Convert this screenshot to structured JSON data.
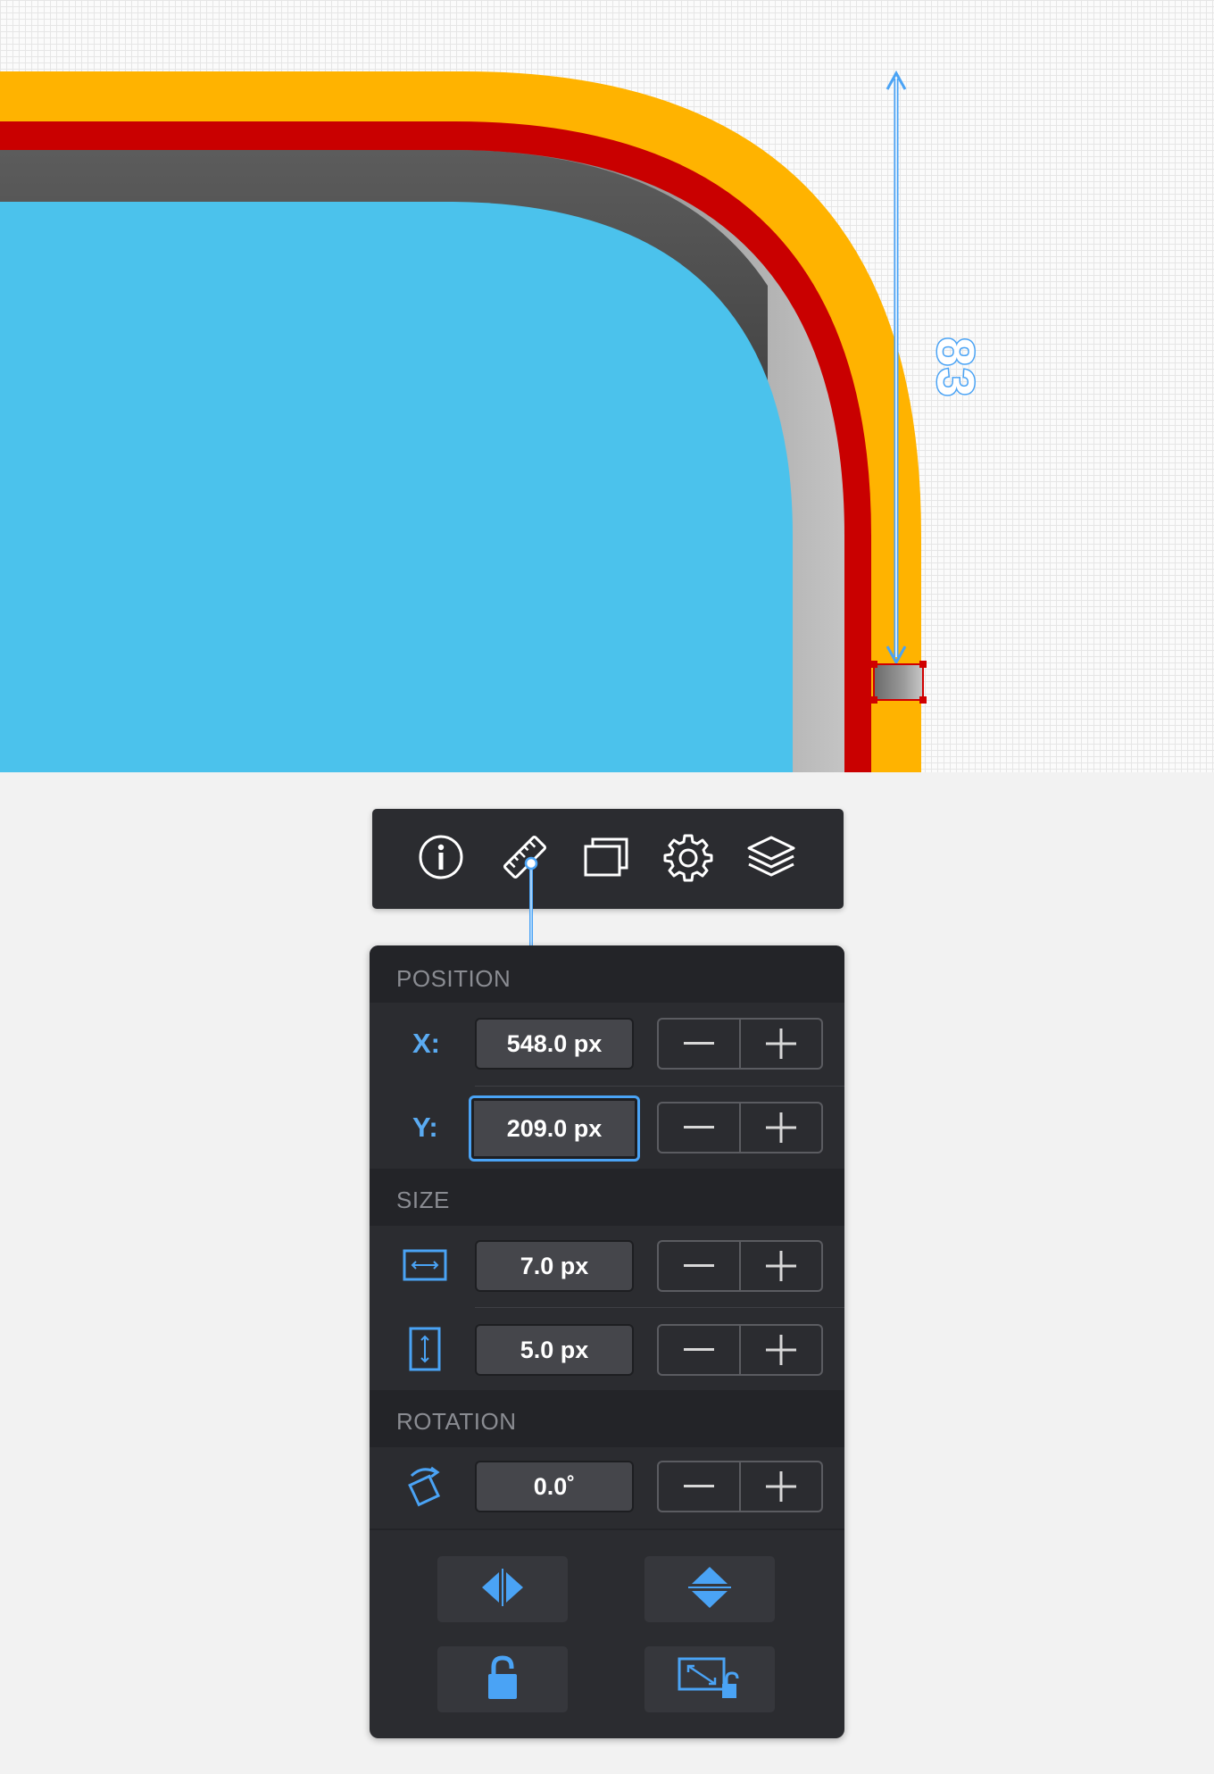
{
  "canvas": {
    "measurement_label": "83",
    "colors": {
      "outer_band": "#ffb300",
      "red_band": "#c90000",
      "screen": "#4bc2ec",
      "guide": "#4aa3f5"
    }
  },
  "toolbar": {
    "items": [
      {
        "name": "info",
        "icon": "info-icon"
      },
      {
        "name": "ruler",
        "icon": "ruler-icon",
        "active": true
      },
      {
        "name": "artboards",
        "icon": "artboard-icon"
      },
      {
        "name": "settings",
        "icon": "gear-icon"
      },
      {
        "name": "layers",
        "icon": "layers-icon"
      }
    ]
  },
  "panel": {
    "position": {
      "heading": "POSITION",
      "x_label": "X:",
      "x_value": "548.0 px",
      "y_label": "Y:",
      "y_value": "209.0 px"
    },
    "size": {
      "heading": "SIZE",
      "width_value": "7.0 px",
      "height_value": "5.0 px"
    },
    "rotation": {
      "heading": "ROTATION",
      "value": "0.0˚"
    },
    "actions": [
      {
        "name": "flip-horizontal",
        "icon": "flip-horizontal-icon"
      },
      {
        "name": "flip-vertical",
        "icon": "flip-vertical-icon"
      },
      {
        "name": "lock",
        "icon": "unlock-icon"
      },
      {
        "name": "scale-lock",
        "icon": "scale-unlock-icon"
      }
    ]
  }
}
